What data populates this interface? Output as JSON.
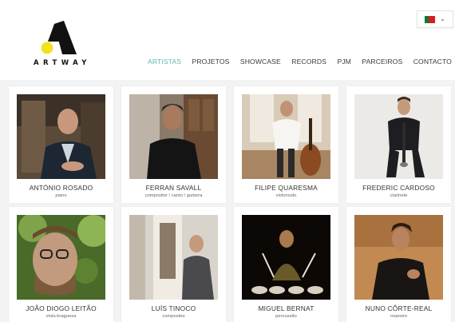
{
  "brand": {
    "name": "ARTWAY"
  },
  "lang": {
    "flag": "flag-portugal-icon",
    "chevron": "⌄"
  },
  "nav": [
    {
      "label": "ARTISTAS",
      "active": true
    },
    {
      "label": "PROJETOS"
    },
    {
      "label": "SHOWCASE"
    },
    {
      "label": "RECORDS"
    },
    {
      "label": "PJM"
    },
    {
      "label": "PARCEIROS"
    },
    {
      "label": "CONTACTO"
    }
  ],
  "artists": [
    {
      "name": "ANTÓNIO ROSADO",
      "role": "piano"
    },
    {
      "name": "FERRAN SAVALL",
      "role": "compositor / canto / guitarra"
    },
    {
      "name": "FILIPE QUARESMA",
      "role": "violoncelo"
    },
    {
      "name": "FREDERIC CARDOSO",
      "role": "clarinete"
    },
    {
      "name": "JOÃO DIOGO LEITÃO",
      "role": "viola braguesa"
    },
    {
      "name": "LUÍS TINOCO",
      "role": "compositor"
    },
    {
      "name": "MIGUEL BERNAT",
      "role": "percussão"
    },
    {
      "name": "NUNO CÔRTE-REAL",
      "role": "maestro"
    }
  ],
  "colors": {
    "accent": "#63b6b6",
    "logo_yellow": "#f2e21d",
    "logo_black": "#111111"
  }
}
